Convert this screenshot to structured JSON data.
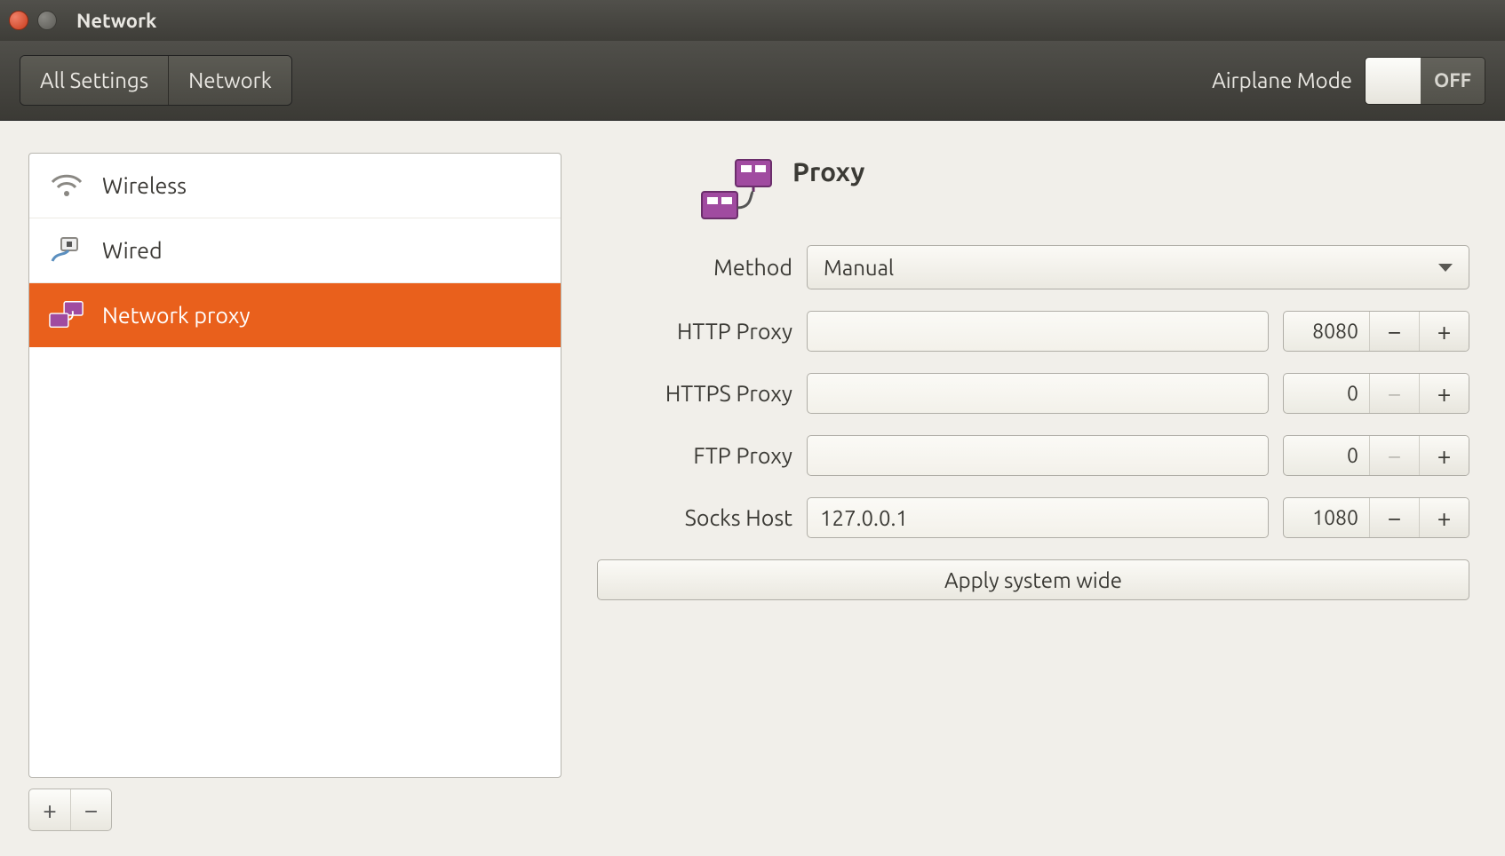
{
  "window": {
    "title": "Network"
  },
  "toolbar": {
    "all_settings": "All Settings",
    "network": "Network",
    "airplane_label": "Airplane Mode",
    "airplane_state": "OFF"
  },
  "sidebar": {
    "items": [
      {
        "label": "Wireless"
      },
      {
        "label": "Wired"
      },
      {
        "label": "Network proxy"
      }
    ],
    "selected_index": 2
  },
  "content": {
    "title": "Proxy",
    "method_label": "Method",
    "method_value": "Manual",
    "rows": [
      {
        "label": "HTTP Proxy",
        "host": "",
        "port": "8080",
        "dec_dim": false
      },
      {
        "label": "HTTPS Proxy",
        "host": "",
        "port": "0",
        "dec_dim": true
      },
      {
        "label": "FTP Proxy",
        "host": "",
        "port": "0",
        "dec_dim": true
      },
      {
        "label": "Socks Host",
        "host": "127.0.0.1",
        "port": "1080",
        "dec_dim": false
      }
    ],
    "apply_label": "Apply system wide"
  }
}
